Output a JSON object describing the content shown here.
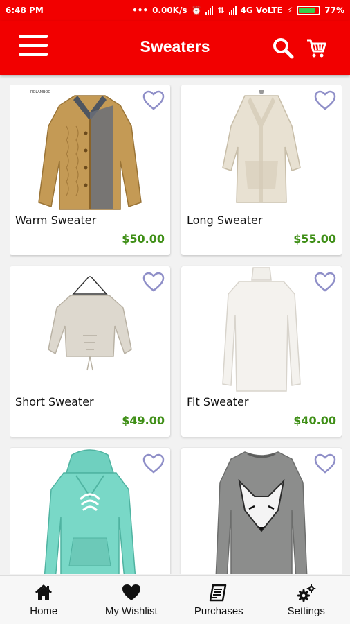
{
  "status_bar": {
    "time": "6:48 PM",
    "network_speed": "0.00K/s",
    "network_type": "4G VoLTE",
    "battery": "77%",
    "battery_level": 0.77,
    "icons": [
      "dots-icon",
      "alarm-icon",
      "signal-icon",
      "data-icon",
      "signal-icon",
      "charging-icon",
      "battery-icon"
    ]
  },
  "app_bar": {
    "title": "Sweaters",
    "menu_icon": "hamburger-menu-icon",
    "search_icon": "search-icon",
    "cart_icon": "cart-icon"
  },
  "products": [
    {
      "name": "Warm Sweater",
      "price": "$50.00",
      "image": "tan-cable-knit-cardigan",
      "favorite": false
    },
    {
      "name": "Long Sweater",
      "price": "$55.00",
      "image": "beige-long-cardigan",
      "favorite": false
    },
    {
      "name": "Short Sweater",
      "price": "$49.00",
      "image": "cream-cropped-sweater",
      "favorite": false
    },
    {
      "name": "Fit Sweater",
      "price": "$40.00",
      "image": "white-turtleneck",
      "favorite": false
    },
    {
      "name": "",
      "price": "",
      "image": "mint-hoodie",
      "favorite": false
    },
    {
      "name": "",
      "price": "",
      "image": "grey-fox-sweatshirt",
      "favorite": false
    }
  ],
  "bottom_nav": [
    {
      "label": "Home",
      "icon": "home-icon"
    },
    {
      "label": "My Wishlist",
      "icon": "heart-icon"
    },
    {
      "label": "Purchases",
      "icon": "receipt-icon"
    },
    {
      "label": "Settings",
      "icon": "gears-icon"
    }
  ],
  "colors": {
    "primary": "#f20000",
    "price": "#3f8f17",
    "heart_outline": "#8f8fc8",
    "battery": "#35d04a"
  }
}
